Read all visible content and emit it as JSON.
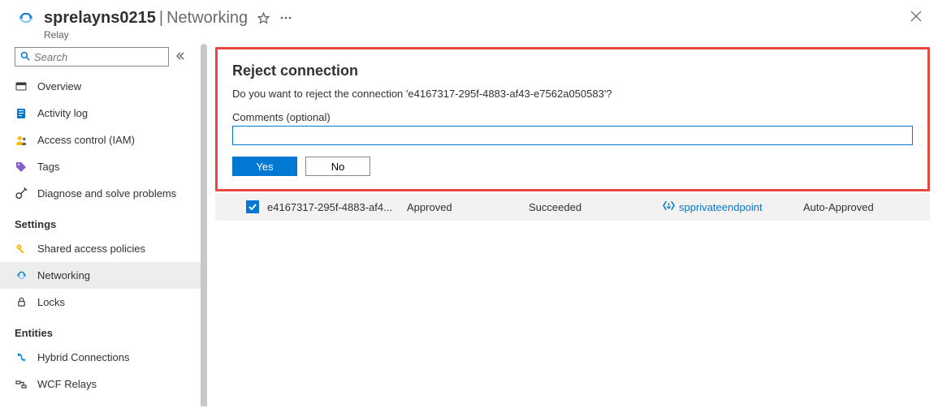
{
  "header": {
    "title": "sprelayns0215",
    "page": "Networking",
    "resource_type": "Relay"
  },
  "sidebar": {
    "search_placeholder": "Search",
    "items": [
      {
        "label": "Overview"
      },
      {
        "label": "Activity log"
      },
      {
        "label": "Access control (IAM)"
      },
      {
        "label": "Tags"
      },
      {
        "label": "Diagnose and solve problems"
      }
    ],
    "settings_heading": "Settings",
    "settings_items": [
      {
        "label": "Shared access policies"
      },
      {
        "label": "Networking",
        "selected": true
      },
      {
        "label": "Locks"
      }
    ],
    "entities_heading": "Entities",
    "entities_items": [
      {
        "label": "Hybrid Connections"
      },
      {
        "label": "WCF Relays"
      }
    ]
  },
  "dialog": {
    "title": "Reject connection",
    "message": "Do you want to reject the connection 'e4167317-295f-4883-af43-e7562a050583'?",
    "comments_label": "Comments (optional)",
    "comments_value": "",
    "yes_label": "Yes",
    "no_label": "No"
  },
  "endpoint_row": {
    "checked": true,
    "name": "e4167317-295f-4883-af4...",
    "connection_state": "Approved",
    "provisioning_status": "Succeeded",
    "private_endpoint": "spprivateendpoint",
    "description": "Auto-Approved"
  }
}
